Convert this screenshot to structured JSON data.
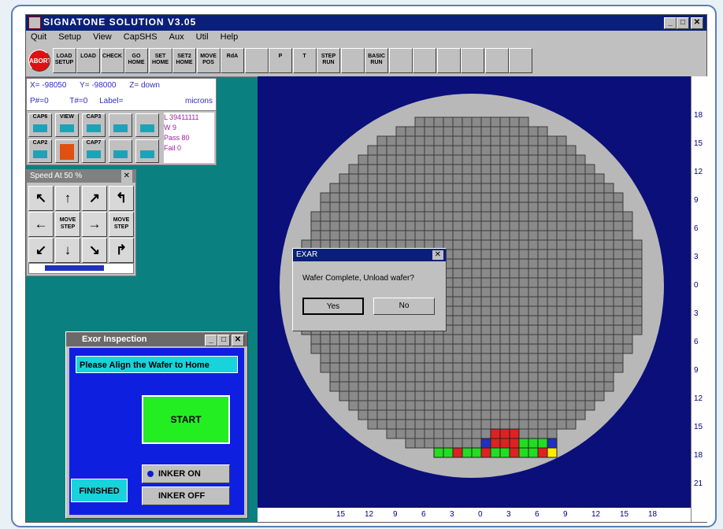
{
  "window": {
    "title": "SIGNATONE SOLUTION V3.05",
    "min": "_",
    "max": "□",
    "close": "✕"
  },
  "menu": [
    "Quit",
    "Setup",
    "View",
    "CapSHS",
    "Aux",
    "Util",
    "Help"
  ],
  "toolbar": [
    {
      "name": "abort-button",
      "label": "ABORT"
    },
    {
      "name": "load-setup-button",
      "label": "LOAD SETUP"
    },
    {
      "name": "load-button",
      "label": "LOAD"
    },
    {
      "name": "check-button",
      "label": "CHECK"
    },
    {
      "name": "go-home-button",
      "label": "GO HOME"
    },
    {
      "name": "set-home-button",
      "label": "SET HOME"
    },
    {
      "name": "set2-home-button",
      "label": "SET2 HOME"
    },
    {
      "name": "move-pos-button",
      "label": "MOVE POS"
    },
    {
      "name": "rda-button",
      "label": "RdA"
    },
    {
      "name": "monitor-button",
      "label": ""
    },
    {
      "name": "p-button",
      "label": "P"
    },
    {
      "name": "t-button",
      "label": "T"
    },
    {
      "name": "step-run-button",
      "label": "STEP RUN"
    },
    {
      "name": "list-button",
      "label": ""
    },
    {
      "name": "basic-run-button",
      "label": "BASIC RUN"
    },
    {
      "name": "globe-button",
      "label": ""
    },
    {
      "name": "color-grid-button",
      "label": ""
    },
    {
      "name": "graph-button",
      "label": ""
    },
    {
      "name": "blank-button-1",
      "label": ""
    },
    {
      "name": "blank-button-2",
      "label": ""
    },
    {
      "name": "blank-button-3",
      "label": ""
    }
  ],
  "coords": {
    "x_label": "X=",
    "x_value": "-98050",
    "y_label": "Y=",
    "y_value": "-98000",
    "z_label": "Z=",
    "z_value": "down",
    "p_label": "P#=0",
    "t_label": "T#=0",
    "label_label": "Label=",
    "units": "microns"
  },
  "cams": [
    "CAP6",
    "VIEW",
    "CAP3",
    "",
    "",
    "CAP2",
    "",
    "CAP7",
    "",
    ""
  ],
  "stats": {
    "l": "L 39411111",
    "w": "W 9",
    "pass_label": "Pass",
    "pass_value": "80",
    "fail_label": "Fail",
    "fail_value": "0"
  },
  "speed": {
    "title": "Speed At 50 %",
    "close": "✕",
    "move_label": "MOVE",
    "step_label": "STEP",
    "level": 0.5
  },
  "jog": [
    "↖",
    "↑",
    "↗",
    "↰",
    "←",
    "",
    "→",
    "",
    "↙",
    "↓",
    "↘",
    "↱"
  ],
  "dialog": {
    "title": "EXAR",
    "message": "Wafer Complete, Unload wafer?",
    "yes": "Yes",
    "no": "No",
    "close": "✕"
  },
  "exor": {
    "title": "Exor Inspection",
    "notice": "Please Align the Wafer to Home",
    "start": "START",
    "finished": "FINISHED",
    "inker_on": "INKER ON",
    "inker_off": "INKER OFF"
  },
  "ruler_right": [
    "18",
    "15",
    "12",
    "9",
    "6",
    "3",
    "0",
    "3",
    "6",
    "9",
    "12",
    "15",
    "18",
    "21"
  ],
  "ruler_bottom": [
    "15",
    "12",
    "9",
    "6",
    "3",
    "0",
    "3",
    "6",
    "9",
    "12",
    "15",
    "18"
  ],
  "colors": {
    "teal": "#0b8080",
    "navy": "#0b0f7a",
    "die_gray": "#8a8a8a",
    "pass": "#22dd22",
    "fail": "#dd2222",
    "cyan": "#19d3dc"
  }
}
